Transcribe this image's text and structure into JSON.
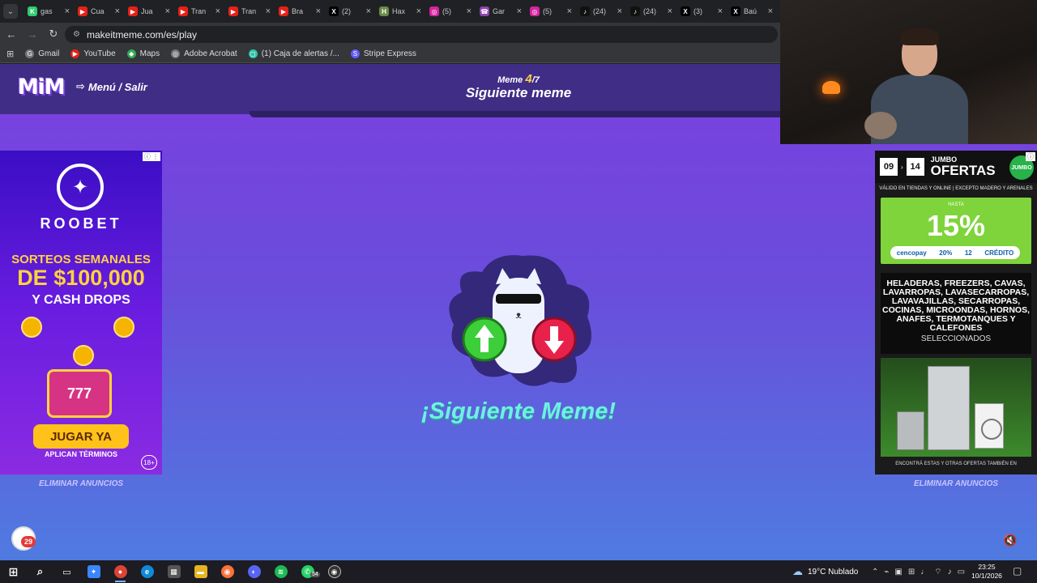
{
  "browser": {
    "tabs": [
      {
        "label": "gas",
        "icon": "k-icon",
        "color": "#2ecc71",
        "glyph": "K"
      },
      {
        "label": "Cua",
        "icon": "youtube-icon",
        "color": "#e62117",
        "glyph": "▶"
      },
      {
        "label": "Jua",
        "icon": "youtube-icon",
        "color": "#e62117",
        "glyph": "▶"
      },
      {
        "label": "Tran",
        "icon": "youtube-icon",
        "color": "#e62117",
        "glyph": "▶"
      },
      {
        "label": "Tran",
        "icon": "youtube-icon",
        "color": "#e62117",
        "glyph": "▶"
      },
      {
        "label": "Bra",
        "icon": "youtube-icon",
        "color": "#e62117",
        "glyph": "▶"
      },
      {
        "label": "(2)",
        "icon": "x-icon",
        "color": "#000000",
        "glyph": "X"
      },
      {
        "label": "Hax",
        "icon": "haxball-icon",
        "color": "#6a8a4a",
        "glyph": "H"
      },
      {
        "label": "(5)",
        "icon": "instagram-icon",
        "color": "#d6249f",
        "glyph": "◎"
      },
      {
        "label": "Gar",
        "icon": "phone-icon",
        "color": "#8e44ad",
        "glyph": "☎"
      },
      {
        "label": "(5)",
        "icon": "instagram-icon",
        "color": "#d6249f",
        "glyph": "◎"
      },
      {
        "label": "(24)",
        "icon": "tiktok-icon",
        "color": "#111111",
        "glyph": "♪"
      },
      {
        "label": "(24)",
        "icon": "tiktok-icon",
        "color": "#111111",
        "glyph": "♪"
      },
      {
        "label": "(3)",
        "icon": "x-icon",
        "color": "#000000",
        "glyph": "X"
      },
      {
        "label": "Baú",
        "icon": "x-icon",
        "color": "#000000",
        "glyph": "X"
      },
      {
        "label": "",
        "icon": "tv-icon",
        "color": "#1e6bd6",
        "glyph": "tv"
      }
    ],
    "url": "makeitmeme.com/es/play",
    "bookmarks": [
      {
        "label": "Gmail",
        "icon": "google-icon",
        "color": "#777777",
        "glyph": "G"
      },
      {
        "label": "YouTube",
        "icon": "youtube-icon",
        "color": "#e62117",
        "glyph": "▶"
      },
      {
        "label": "Maps",
        "icon": "maps-icon",
        "color": "#34a853",
        "glyph": "◆"
      },
      {
        "label": "Adobe Acrobat",
        "icon": "globe-icon",
        "color": "#777777",
        "glyph": "◎"
      },
      {
        "label": "(1) Caja de alertas /...",
        "icon": "alerts-icon",
        "color": "#2ec4a6",
        "glyph": "◻"
      },
      {
        "label": "Stripe Express",
        "icon": "stripe-icon",
        "color": "#635bff",
        "glyph": "S"
      }
    ]
  },
  "game": {
    "logo": "MiM",
    "menu_label": "Menú / Salir",
    "counter_prefix": "Meme",
    "counter_current": "4",
    "counter_total": "/7",
    "title": "Siguiente meme",
    "cta": "¡Siguiente Meme!",
    "remove_ads": "ELIMINAR ANUNCIOS",
    "chat_count": "29"
  },
  "ad_left": {
    "brand": "ROOBET",
    "line1": "SORTEOS SEMANALES",
    "line2": "DE $100,000",
    "line3": "Y CASH DROPS",
    "slot": "777",
    "button": "JUGAR YA",
    "terms": "APLICAN TÉRMINOS",
    "age": "18+"
  },
  "ad_right": {
    "day_from": "09",
    "day_to": "14",
    "brand_top": "JUMBO",
    "title": "OFERTAS",
    "logo": "JUMBO",
    "valid": "VÁLIDO EN TIENDAS Y ONLINE | EXCEPTO MADERO Y ARENALES",
    "hasta": "HASTA",
    "pct": "15%",
    "pay_brand": "cencopay",
    "pay_20": "20%",
    "pay_12": "12",
    "pay_credit": "CRÉDITO",
    "items": "HELADERAS, FREEZERS, CAVAS, LAVARROPAS, LAVASECARROPAS, LAVAVAJILLAS, SECARROPAS, COCINAS, MICROONDAS, HORNOS, ANAFES, TERMOTANQUES Y CALEFONES",
    "selected": "SELECCIONADOS",
    "footer": "ENCONTRÁ ESTAS Y OTRAS OFERTAS TAMBIÉN EN"
  },
  "taskbar": {
    "weather": "19°C  Nublado",
    "time": "23:25",
    "date": "10/1/2026",
    "whatsapp_badge": "54"
  }
}
